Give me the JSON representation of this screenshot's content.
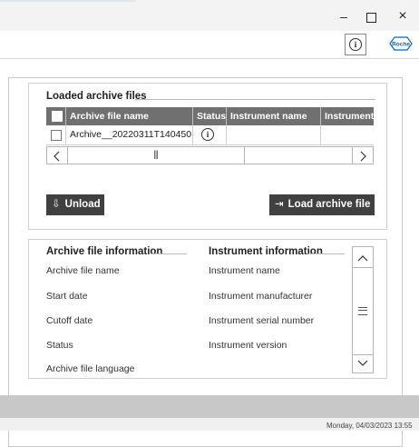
{
  "window": {
    "minimize_label": "–",
    "close_label": "×",
    "info_label": "i",
    "brand": "Roche"
  },
  "loaded_archive_files": {
    "title": "Loaded archive files",
    "columns": [
      "Archive file name",
      "Status",
      "Instrument name",
      "Instrument"
    ],
    "rows": [
      {
        "archive_file_name": "Archive__20220311T140450",
        "status_icon": "info-icon",
        "status_symbol": "i",
        "instrument_name": "",
        "instrument": ""
      }
    ],
    "scroll": {
      "left": "<",
      "thumb": "|||",
      "right": ">"
    }
  },
  "actions": {
    "unload_label": "Unload",
    "unload_icon": "⇩",
    "load_label": "Load archive file",
    "load_icon": "⇥"
  },
  "archive_info": {
    "title": "Archive file information",
    "labels": [
      "Archive file name",
      "Start date",
      "Cutoff date",
      "Status",
      "Archive file language"
    ]
  },
  "instrument_info": {
    "title": "Instrument information",
    "labels": [
      "Instrument name",
      "Instrument manufacturer",
      "Instrument serial number",
      "Instrument version"
    ]
  },
  "vscroll": {
    "up": "^",
    "down": "v"
  },
  "taskbar": {
    "datetime": "Monday, 04/03/2023 13:55"
  },
  "colors": {
    "header_bg": "#707070",
    "button_bg": "#404040",
    "brand_blue": "#0066cc"
  }
}
